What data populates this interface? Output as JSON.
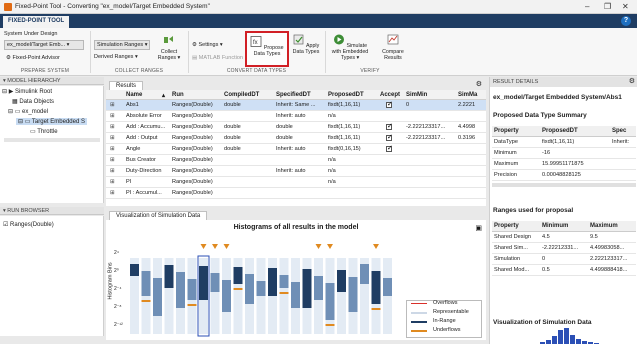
{
  "window": {
    "title": "Fixed-Point Tool - Converting \"ex_model/Target Embedded System\"",
    "tab": "FIXED-POINT TOOL",
    "help": "?",
    "min": "–",
    "max": "❐",
    "close": "✕"
  },
  "ribbon": {
    "system_under_design_label": "System Under Design",
    "system_value": "ex_model/Target Emb...",
    "fpa_label": "Fixed-Point Advisor",
    "prepare_label": "PREPARE SYSTEM",
    "collect_mode": "Simulation Ranges",
    "derived_ranges": "Derived Ranges",
    "collect_ranges_btn": "Collect Ranges",
    "collect_label": "COLLECT RANGES",
    "settings_btn": "Settings",
    "matlab_function": "MATLAB Function",
    "propose_btn": "Propose Data Types",
    "apply_btn": "Apply Data Types",
    "convert_label": "CONVERT DATA TYPES",
    "simulate_btn": "Simulate with Embedded Types",
    "compare_btn": "Compare Results",
    "verify_label": "VERIFY"
  },
  "left": {
    "model_hierarchy": "MODEL HIERARCHY",
    "tree": [
      "Simulink Root",
      "Data Objects",
      "ex_model",
      "Target Embedded S",
      "Throttle"
    ],
    "run_browser": "RUN BROWSER",
    "run_item": "Ranges(Double)"
  },
  "results": {
    "tab": "Results",
    "columns": [
      "Name",
      "Run",
      "CompiledDT",
      "SpecifiedDT",
      "ProposedDT",
      "Accept",
      "SimMin",
      "SimMa"
    ],
    "rows": [
      {
        "name": "Abs1",
        "run": "Ranges(Double)",
        "compiled": "double",
        "specified": "Inherit: Same ...",
        "proposed": "fixdt(1,16,11)",
        "accept": true,
        "simmin": "0",
        "simmax": "2.2221"
      },
      {
        "name": "Absolute Error",
        "run": "Ranges(Double)",
        "compiled": "",
        "specified": "Inherit: auto",
        "proposed": "n/a",
        "accept": false,
        "simmin": "",
        "simmax": ""
      },
      {
        "name": "Add : Accumu...",
        "run": "Ranges(Double)",
        "compiled": "double",
        "specified": "double",
        "proposed": "fixdt(1,16,11)",
        "accept": true,
        "simmin": "-2.222123317...",
        "simmax": "4.4998"
      },
      {
        "name": "Add : Output",
        "run": "Ranges(Double)",
        "compiled": "double",
        "specified": "double",
        "proposed": "fixdt(1,16,11)",
        "accept": true,
        "simmin": "-2.222123317...",
        "simmax": "0.3196"
      },
      {
        "name": "Angle",
        "run": "Ranges(Double)",
        "compiled": "double",
        "specified": "Inherit: auto",
        "proposed": "fixdt(0,16,15)",
        "accept": true,
        "simmin": "",
        "simmax": ""
      },
      {
        "name": "Bus Creator",
        "run": "Ranges(Double)",
        "compiled": "",
        "specified": "",
        "proposed": "n/a",
        "accept": false,
        "simmin": "",
        "simmax": ""
      },
      {
        "name": "Duty-Direction",
        "run": "Ranges(Double)",
        "compiled": "",
        "specified": "Inherit: auto",
        "proposed": "n/a",
        "accept": false,
        "simmin": "",
        "simmax": ""
      },
      {
        "name": "PI",
        "run": "Ranges(Double)",
        "compiled": "",
        "specified": "",
        "proposed": "n/a",
        "accept": false,
        "simmin": "",
        "simmax": ""
      },
      {
        "name": "PI : Accumul...",
        "run": "Ranges(Double)",
        "compiled": "",
        "specified": "",
        "proposed": "",
        "accept": false,
        "simmin": "",
        "simmax": ""
      }
    ]
  },
  "viz": {
    "tab": "Visualization of Simulation Data",
    "title": "Histograms of all results in the model",
    "ylabel": "Histogram Bins",
    "ticks": [
      "2⁴",
      "2⁰",
      "2⁻⁴",
      "2⁻⁸",
      "2⁻¹²"
    ],
    "legend": [
      "Overflows",
      "Representable",
      "In-Range",
      "Underflows"
    ]
  },
  "right": {
    "head": "RESULT DETAILS",
    "path": "ex_model/Target Embedded System/Abs1",
    "summary_title": "Proposed Data Type Summary",
    "summary_cols": [
      "Property",
      "ProposedDT",
      "Spec"
    ],
    "summary_rows": [
      [
        "DataType",
        "fixdt(1,16,11)",
        "Inherit:"
      ],
      [
        "Minimum",
        "-16",
        ""
      ],
      [
        "Maximum",
        "15.99951171875",
        ""
      ],
      [
        "Precision",
        "0.00048828125",
        ""
      ]
    ],
    "ranges_title": "Ranges used for proposal",
    "ranges_cols": [
      "Property",
      "Minimum",
      "Maximum"
    ],
    "ranges_rows": [
      [
        "Shared Design",
        "4.5",
        "9.5"
      ],
      [
        "Shared Sim...",
        "-2.22212331...",
        "4.49983058..."
      ],
      [
        "Simulation",
        "0",
        "2.222123317..."
      ],
      [
        "Shared Mod...",
        "0.5",
        "4.499888418..."
      ]
    ],
    "viz_title": "Visualization of Simulation Data"
  },
  "colors": {
    "accent": "#1f3d63",
    "highlight": "#d11f25",
    "overflow": "#d9302a",
    "underflow": "#e08a20",
    "inrange": "#2b4fb5"
  }
}
